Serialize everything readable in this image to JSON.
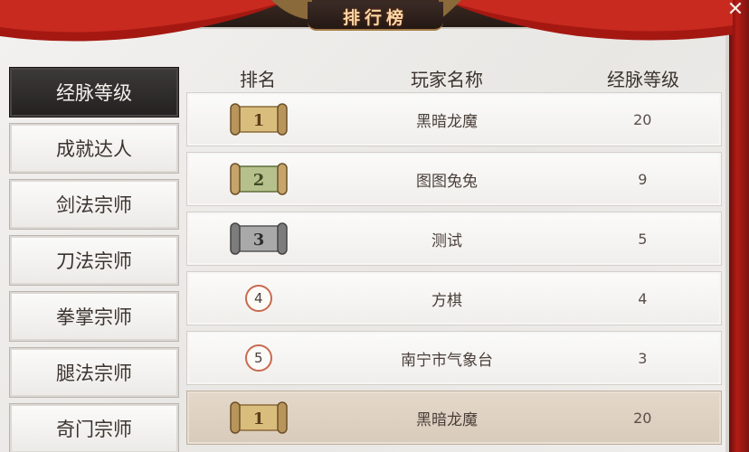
{
  "window": {
    "title": "排行榜",
    "close_icon": "✕"
  },
  "sidebar": {
    "items": [
      {
        "label": "经脉等级",
        "active": true
      },
      {
        "label": "成就达人",
        "active": false
      },
      {
        "label": "剑法宗师",
        "active": false
      },
      {
        "label": "刀法宗师",
        "active": false
      },
      {
        "label": "拳掌宗师",
        "active": false
      },
      {
        "label": "腿法宗师",
        "active": false
      },
      {
        "label": "奇门宗师",
        "active": false
      }
    ]
  },
  "table": {
    "headers": {
      "rank": "排名",
      "name": "玩家名称",
      "level": "经脉等级"
    },
    "rows": [
      {
        "rank": "1",
        "rank_style": "gold-scroll",
        "name": "黑暗龙魔",
        "level": "20"
      },
      {
        "rank": "2",
        "rank_style": "green-scroll",
        "name": "图图兔兔",
        "level": "9"
      },
      {
        "rank": "3",
        "rank_style": "silver-scroll",
        "name": "测试",
        "level": "5"
      },
      {
        "rank": "4",
        "rank_style": "circle",
        "name": "方棋",
        "level": "4"
      },
      {
        "rank": "5",
        "rank_style": "circle",
        "name": "南宁市气象台",
        "level": "3"
      }
    ],
    "self_row": {
      "rank": "1",
      "rank_style": "gold-scroll",
      "name": "黑暗龙魔",
      "level": "20"
    }
  },
  "colors": {
    "banner_red": "#b31c16",
    "title_gold": "#f6d9a6",
    "gold_scroll": "#d9bd7c",
    "green_scroll": "#b5c08d",
    "silver_scroll": "#a9a9a9",
    "circle_border": "#c86a50"
  }
}
